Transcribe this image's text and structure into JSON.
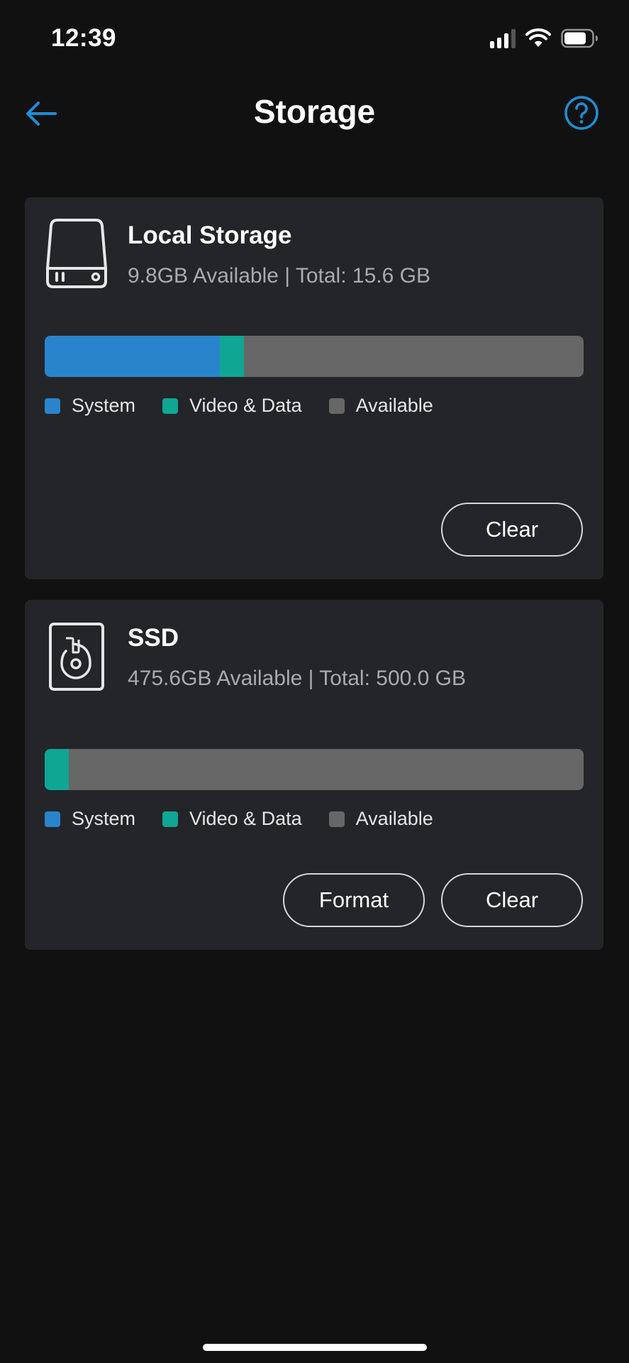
{
  "status_bar": {
    "time": "12:39",
    "icons": [
      "cellular-signal-icon",
      "wifi-icon",
      "battery-icon"
    ]
  },
  "nav": {
    "title": "Storage",
    "back_icon": "back-arrow-icon",
    "help_icon": "help-question-icon"
  },
  "colors": {
    "accent": "#1e8fd8",
    "system": "#2a84cc",
    "video_data": "#10a694",
    "available": "#676767",
    "card_bg": "#232528",
    "page_bg": "#111111"
  },
  "legend": {
    "system": "System",
    "video_data": "Video & Data",
    "available": "Available"
  },
  "local_storage": {
    "title": "Local Storage",
    "subtitle": "9.8GB Available | Total:  15.6 GB",
    "icon": "hard-drive-icon",
    "usage_fraction": {
      "system": 0.325,
      "video_data": 0.045,
      "available": 0.63
    },
    "clear_label": "Clear"
  },
  "ssd": {
    "title": "SSD",
    "subtitle": "475.6GB Available | Total:  500.0 GB",
    "icon": "ssd-disk-icon",
    "usage_fraction": {
      "system": 0.0,
      "video_data": 0.045,
      "available": 0.955
    },
    "format_label": "Format",
    "clear_label": "Clear"
  }
}
